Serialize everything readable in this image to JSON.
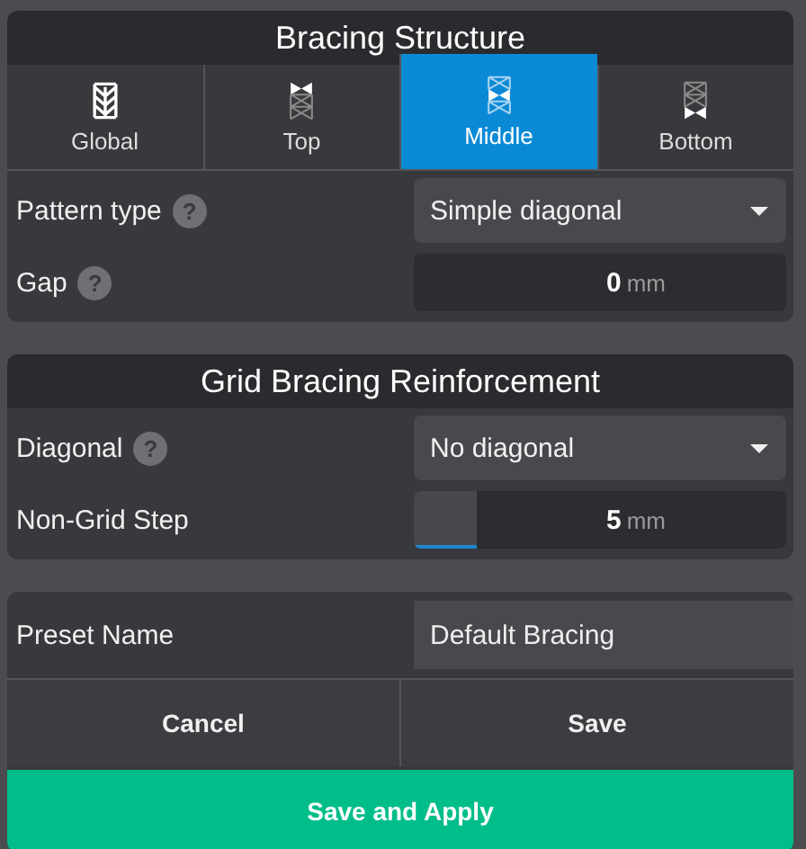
{
  "bracing_structure": {
    "title": "Bracing Structure",
    "tabs": [
      {
        "label": "Global",
        "kind": "global",
        "selected": false
      },
      {
        "label": "Top",
        "kind": "top",
        "selected": false
      },
      {
        "label": "Middle",
        "kind": "middle",
        "selected": true
      },
      {
        "label": "Bottom",
        "kind": "bottom",
        "selected": false
      }
    ],
    "fields": [
      {
        "label": "Pattern type",
        "help": "?",
        "kind": "dropdown",
        "value": "Simple diagonal"
      },
      {
        "label": "Gap",
        "help": "?",
        "kind": "number",
        "value": "0",
        "unit": "mm"
      }
    ]
  },
  "grid_bracing_reinforcement": {
    "title": "Grid Bracing Reinforcement",
    "fields": [
      {
        "label": "Diagonal",
        "help": "?",
        "kind": "dropdown",
        "value": "No diagonal"
      },
      {
        "label": "Non-Grid Step",
        "kind": "number",
        "value": "5",
        "unit": "mm",
        "level": 0.17
      }
    ]
  },
  "preset": {
    "label": "Preset Name",
    "value": "Default Bracing",
    "buttons": [
      {
        "label": "Cancel",
        "kind": "plain"
      },
      {
        "label": "Save",
        "kind": "plain"
      },
      {
        "label": "Save and Apply",
        "kind": "primary"
      }
    ]
  }
}
